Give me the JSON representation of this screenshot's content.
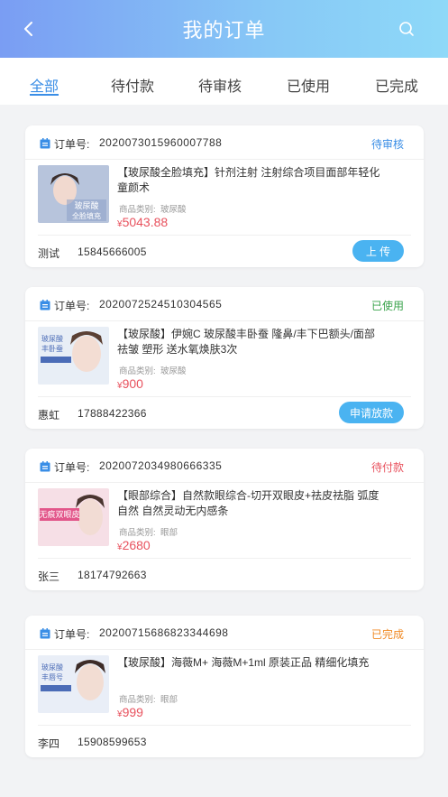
{
  "header": {
    "title": "我的订单",
    "back_icon": "back-chevron-icon",
    "search_icon": "search-icon"
  },
  "tabs": [
    {
      "label": "全部",
      "active": true
    },
    {
      "label": "待付款",
      "active": false
    },
    {
      "label": "待审核",
      "active": false
    },
    {
      "label": "已使用",
      "active": false
    },
    {
      "label": "已完成",
      "active": false
    }
  ],
  "order_label": "订单号:",
  "category_label": "商品类别:",
  "currency": "¥",
  "colors": {
    "accent": "#3a8ee6",
    "price": "#e8525e",
    "button": "#4ab3f1",
    "status_review": "#3a8ee6",
    "status_used": "#3aa34b",
    "status_pending": "#e8525e",
    "status_done": "#f08a24"
  },
  "orders": [
    {
      "order_no": "2020073015960007788",
      "status": "待审核",
      "title": "【玻尿酸全脸填充】针剂注射 注射综合项目面部年轻化童颜术",
      "thumb_text": "玻尿酸全脸填充",
      "category": "玻尿酸",
      "price": "5043.88",
      "customer_name": "测试",
      "phone": "15845666005",
      "action": "上 传"
    },
    {
      "order_no": "2020072524510304565",
      "status": "已使用",
      "title": "【玻尿酸】伊婉C 玻尿酸丰卧蚕 隆鼻/丰下巴额头/面部 祛皱 塑形 送水氧焕肤3次",
      "thumb_text": "玻尿酸丰卧蚕",
      "category": "玻尿酸",
      "price": "900",
      "customer_name": "惠虹",
      "phone": "17888422366",
      "action": "申请放款"
    },
    {
      "order_no": "2020072034980666335",
      "status": "待付款",
      "title": "【眼部综合】自然款眼综合-切开双眼皮+祛皮祛脂 弧度自然 自然灵动无内感条",
      "thumb_text": "无痕双眼皮",
      "category": "眼部",
      "price": "2680",
      "customer_name": "张三",
      "phone": "18174792663",
      "action": ""
    },
    {
      "order_no": "20200715686823344698",
      "status": "已完成",
      "title": "【玻尿酸】海薇M+ 海薇M+1ml 原装正品 精细化填充",
      "thumb_text": "玻尿酸丰唇",
      "category": "眼部",
      "price": "999",
      "customer_name": "李四",
      "phone": "15908599653",
      "action": ""
    }
  ]
}
